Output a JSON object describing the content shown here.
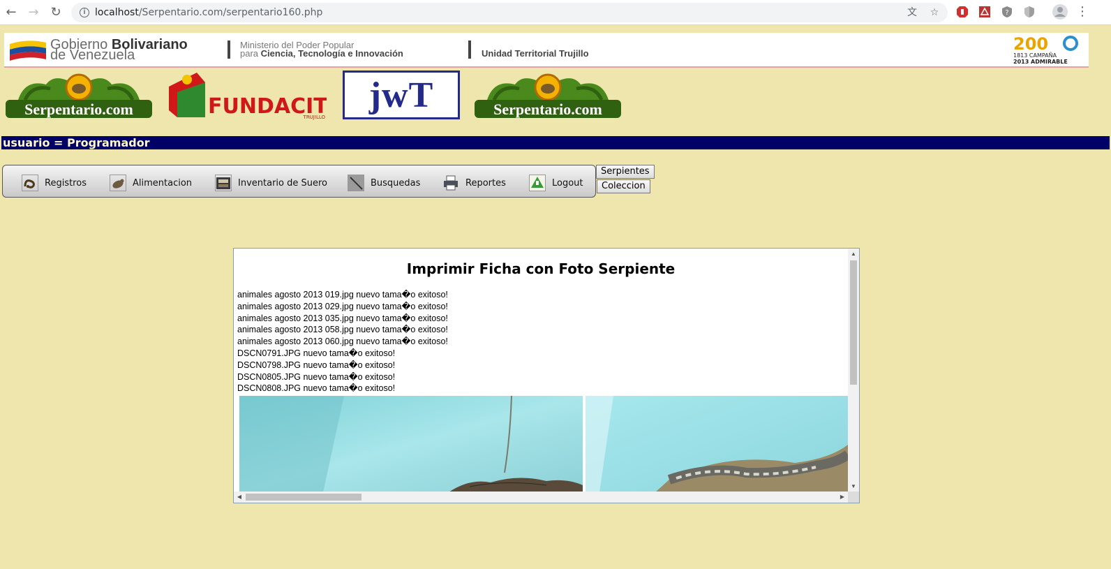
{
  "browser": {
    "url_host": "localhost",
    "url_path": "/Serpentario.com/serpentario160.php"
  },
  "banner": {
    "gov_word1": "Gobierno",
    "gov_word2": "Bolivariano",
    "gov_line2": "de Venezuela",
    "ministry_line1": "Ministerio del Poder Popular",
    "ministry_prefix": "para",
    "ministry_bold": "Ciencia, Tecnología e Innovación",
    "unit": "Unidad Territorial Trujillo",
    "campaign_top": "200",
    "campaign_line1": "1813 CAMPAÑA",
    "campaign_line2": "2013 ADMIRABLE"
  },
  "logos": {
    "serpentario": "Serpentario.com",
    "fundacite": "FUNDACITE",
    "fundacite_sub": "TRUJILLO",
    "jwt": "jwT"
  },
  "user_bar": "usuario = Programador",
  "menu": {
    "items": [
      {
        "label": "Registros",
        "icon": "snake-icon"
      },
      {
        "label": "Alimentacion",
        "icon": "rat-icon"
      },
      {
        "label": "Inventario de Suero",
        "icon": "serum-box-icon"
      },
      {
        "label": "Busquedas",
        "icon": "search-stick-icon"
      },
      {
        "label": "Reportes",
        "icon": "printer-icon"
      },
      {
        "label": "Logout",
        "icon": "logout-icon"
      }
    ],
    "side_buttons": [
      "Serpientes",
      "Coleccion"
    ]
  },
  "content": {
    "title": "Imprimir Ficha con Foto Serpiente",
    "messages": [
      "animales agosto 2013 019.jpg nuevo tama�o exitoso!",
      "animales agosto 2013 029.jpg nuevo tama�o exitoso!",
      "animales agosto 2013 035.jpg nuevo tama�o exitoso!",
      "animales agosto 2013 058.jpg nuevo tama�o exitoso!",
      "animales agosto 2013 060.jpg nuevo tama�o exitoso!",
      "DSCN0791.JPG nuevo tama�o exitoso!",
      "DSCN0798.JPG nuevo tama�o exitoso!",
      "DSCN0805.JPG nuevo tama�o exitoso!",
      "DSCN0808.JPG nuevo tama�o exitoso!"
    ]
  },
  "colors": {
    "page_bg": "#eee6ac",
    "user_bar_bg": "#000066",
    "user_bar_text": "#fff7c8",
    "frame_border": "#8a9db0"
  }
}
